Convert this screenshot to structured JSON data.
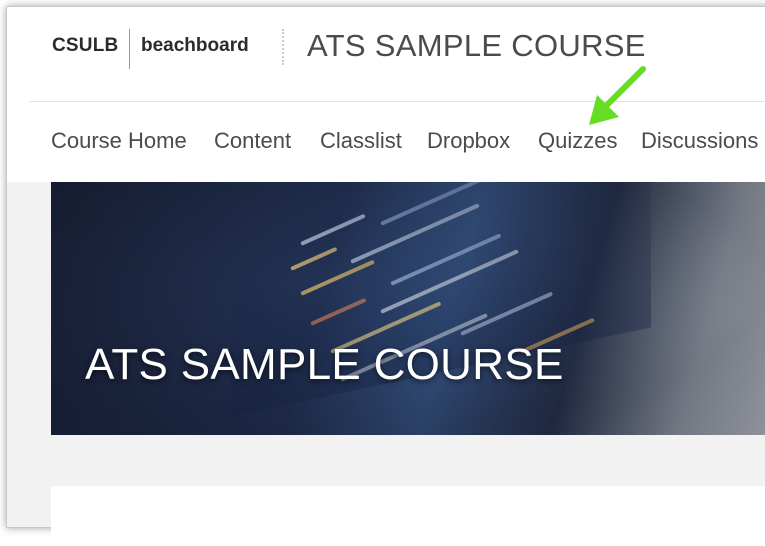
{
  "header": {
    "logo_csulb": "CSULB",
    "logo_beachboard": "beachboard",
    "course_title": "ATS SAMPLE COURSE"
  },
  "nav": {
    "items": [
      {
        "label": "Course Home"
      },
      {
        "label": "Content"
      },
      {
        "label": "Classlist"
      },
      {
        "label": "Dropbox"
      },
      {
        "label": "Quizzes"
      },
      {
        "label": "Discussions"
      }
    ]
  },
  "banner": {
    "title": "ATS SAMPLE COURSE"
  },
  "annotation": {
    "arrow_icon": "arrow-pointing-down-left-icon",
    "arrow_color": "#66dd22"
  },
  "colors": {
    "text": "#494c4e",
    "banner_dark": "#1a2238"
  }
}
